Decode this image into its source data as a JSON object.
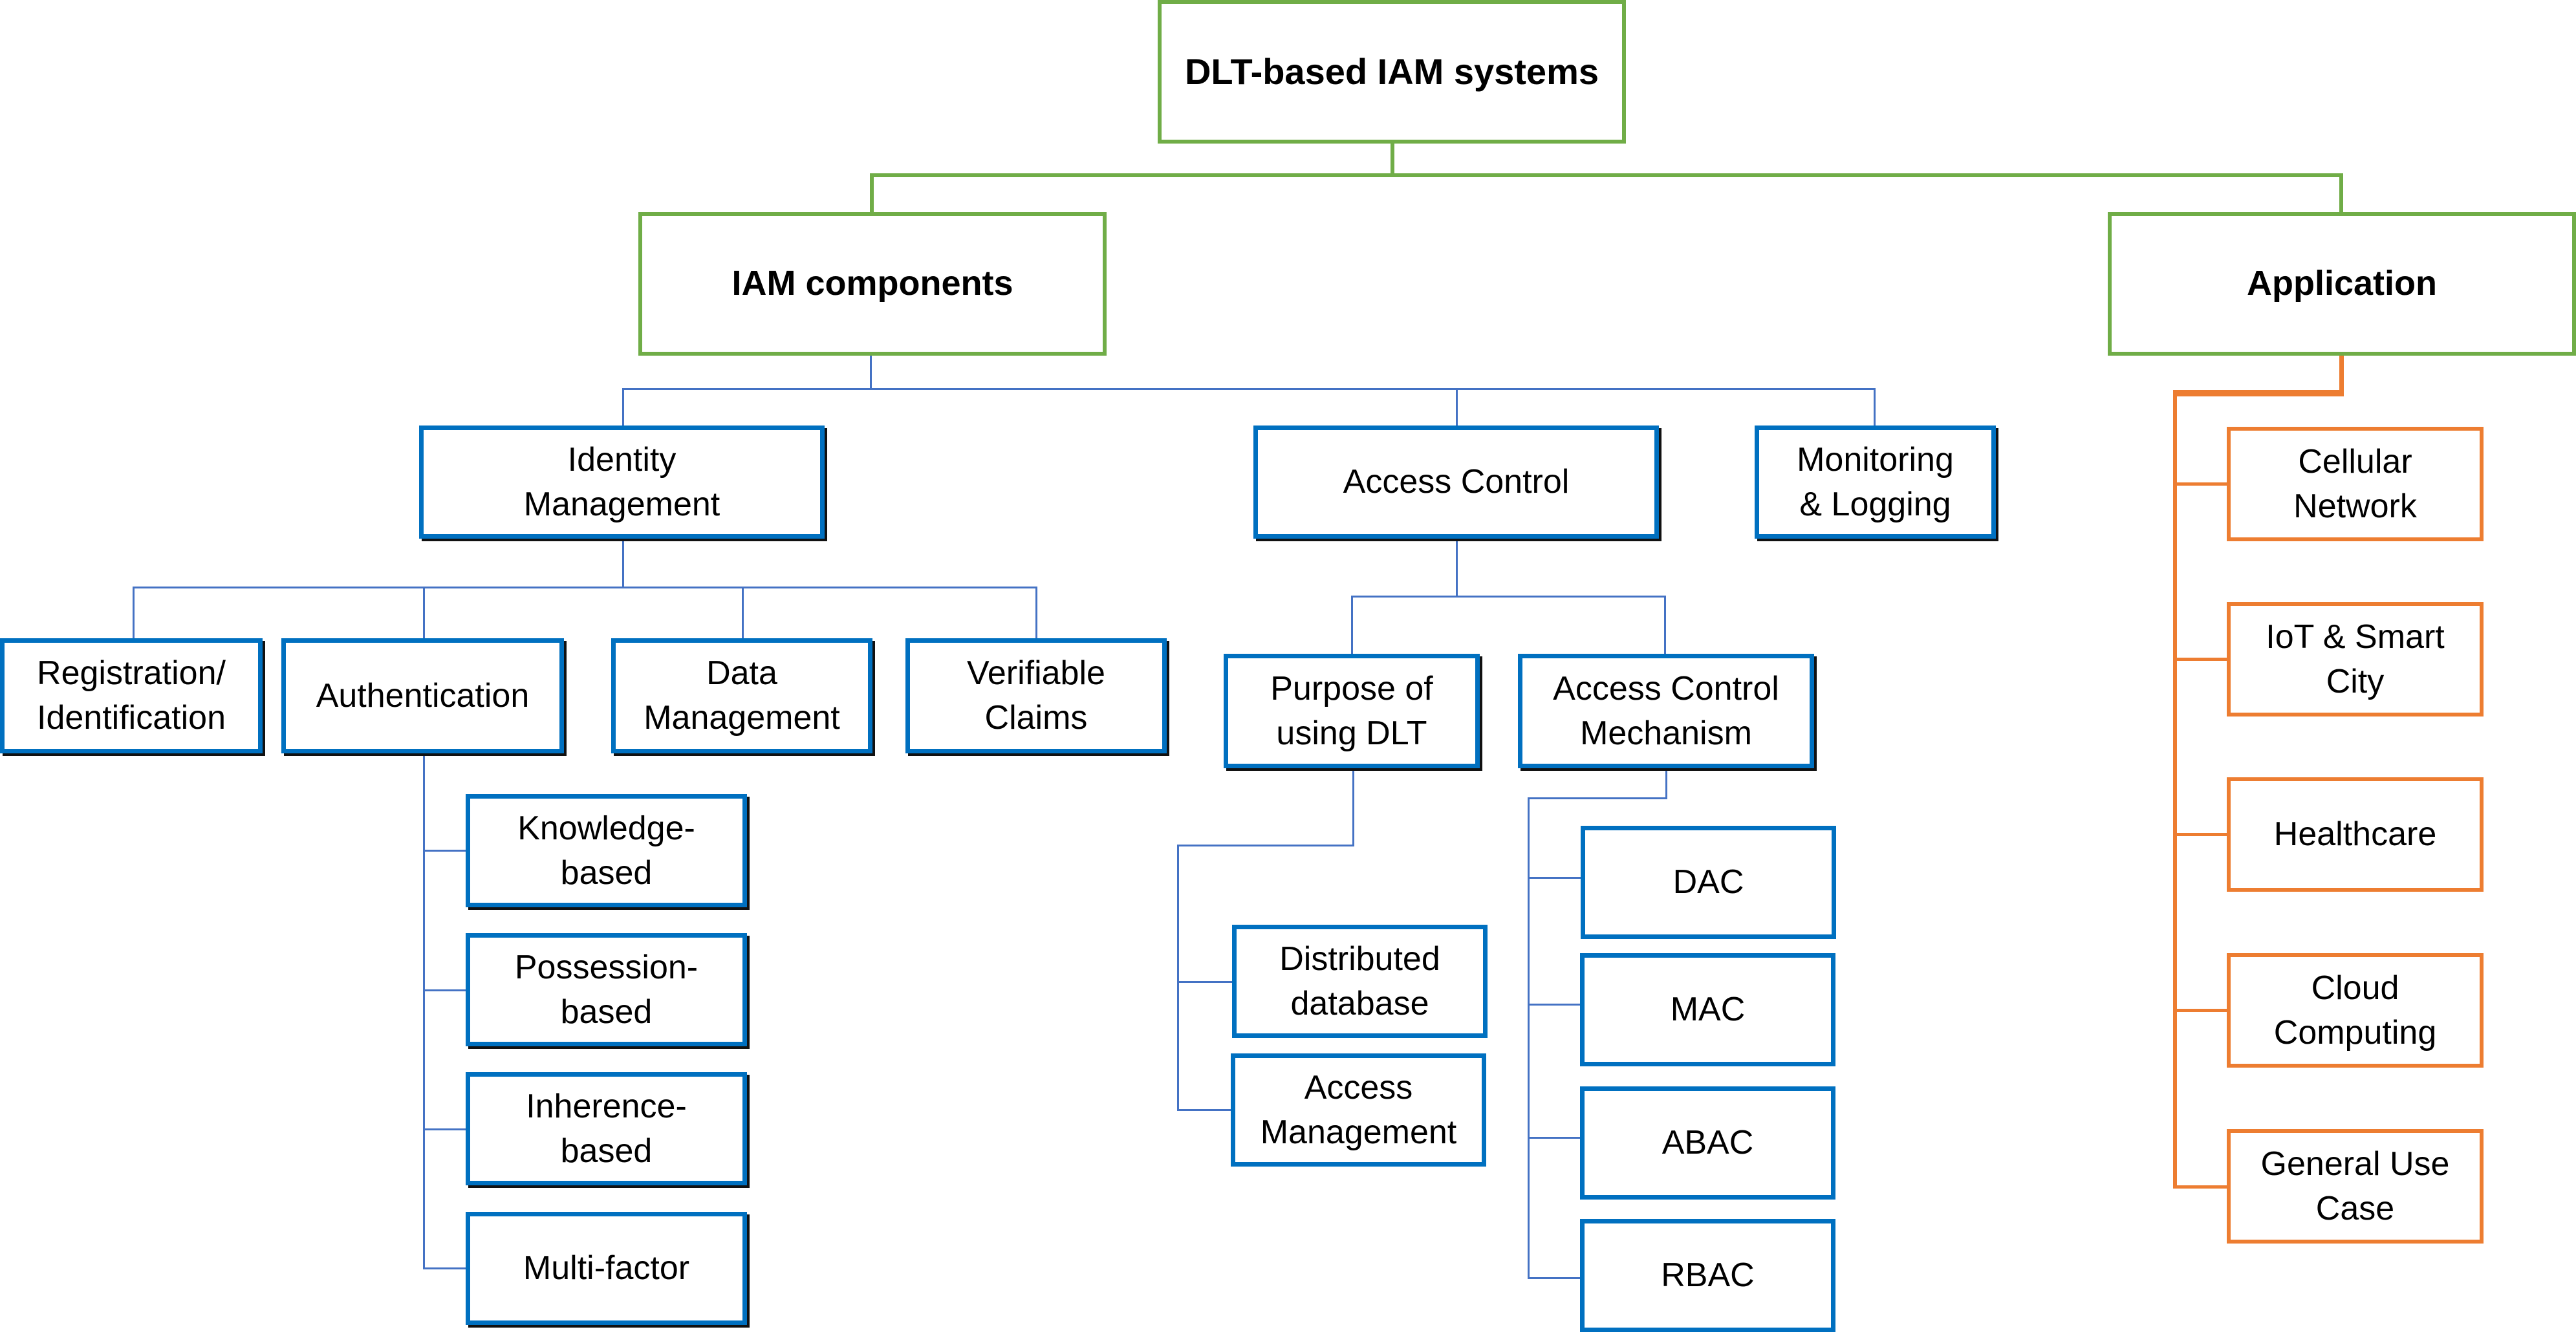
{
  "diagram": {
    "root": {
      "label": "DLT-based IAM systems"
    },
    "iam_components": {
      "label": "IAM components"
    },
    "application": {
      "label": "Application"
    },
    "identity_management": {
      "label": "Identity\nManagement"
    },
    "access_control": {
      "label": "Access Control"
    },
    "monitoring": {
      "label": "Monitoring\n& Logging"
    },
    "registration": {
      "label": "Registration/\nIdentification"
    },
    "authentication": {
      "label": "Authentication"
    },
    "data_management": {
      "label": "Data\nManagement"
    },
    "verifiable_claims": {
      "label": "Verifiable\nClaims"
    },
    "knowledge": {
      "label": "Knowledge-\nbased"
    },
    "possession": {
      "label": "Possession-\nbased"
    },
    "inherence": {
      "label": "Inherence-\nbased"
    },
    "multifactor": {
      "label": "Multi-factor"
    },
    "purpose": {
      "label": "Purpose of\nusing DLT"
    },
    "acm": {
      "label": "Access Control\nMechanism"
    },
    "distributed_db": {
      "label": "Distributed\ndatabase"
    },
    "access_mgmt": {
      "label": "Access\nManagement"
    },
    "dac": {
      "label": "DAC"
    },
    "mac": {
      "label": "MAC"
    },
    "abac": {
      "label": "ABAC"
    },
    "rbac": {
      "label": "RBAC"
    },
    "cellular": {
      "label": "Cellular\nNetwork"
    },
    "iot": {
      "label": "IoT & Smart\nCity"
    },
    "healthcare": {
      "label": "Healthcare"
    },
    "cloud": {
      "label": "Cloud\nComputing"
    },
    "general": {
      "label": "General Use\nCase"
    }
  },
  "colors": {
    "level1": "#70ad47",
    "components": "#0070c0",
    "connectors": "#4472c4",
    "application": "#ed7d31"
  }
}
